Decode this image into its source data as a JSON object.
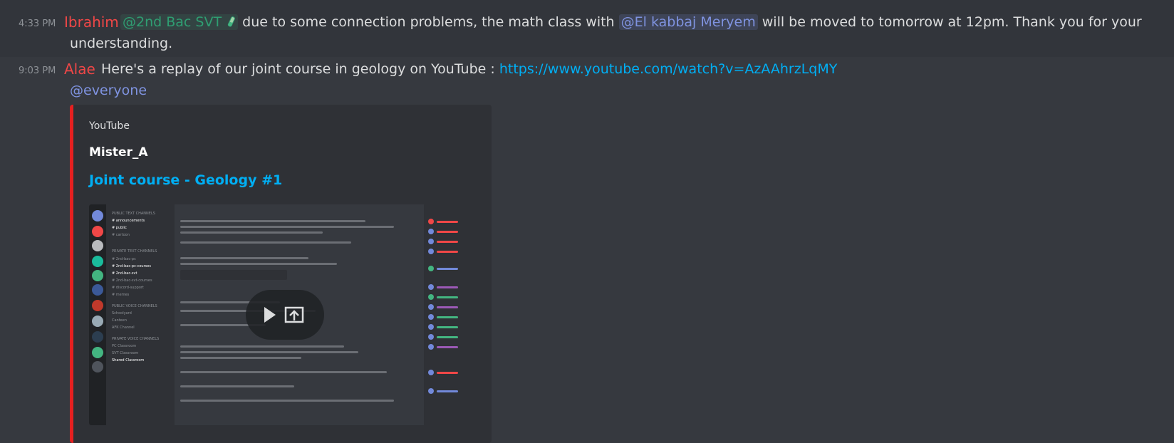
{
  "messages": [
    {
      "time": "4:33 PM",
      "author": "Ibrahim",
      "author_color": "#f04747",
      "role_mention": "@2nd Bac SVT",
      "text_part1": "due to some connection problems, the math class with",
      "user_mention": "@El kabbaj Meryem",
      "text_part2": "will be moved to tomorrow at 12pm. Thank you for your",
      "text_line2": "understanding."
    },
    {
      "time": "9:03 PM",
      "author": "Alae",
      "author_color": "#f04747",
      "text": "Here's a replay of our joint course in geology on YouTube :",
      "link": "https://www.youtube.com/watch?v=AzAAhrzLqMY",
      "mention": "@everyone"
    }
  ],
  "embed": {
    "provider": "YouTube",
    "author": "Mister_A",
    "title": "Joint course - Geology #1",
    "accent_color": "#e52020"
  },
  "thumbnail": {
    "channels": [
      "announcements",
      "public",
      "cartoon",
      "PRIVATE TEXT CHANNELS",
      "2nd-bac-pc",
      "2nd-bac-pc-courses",
      "2nd-bac-svt",
      "2nd-bac-svt-courses",
      "discord-support",
      "memes",
      "PUBLIC VOICE CHANNELS",
      "Schoolyard",
      "Canteen",
      "AFK Channel",
      "PRIVATE VOICE CHANNELS",
      "PC Classroom",
      "SVT Classroom",
      "Shared Classroom"
    ],
    "icons": [
      "play-icon",
      "open-external-icon"
    ]
  }
}
